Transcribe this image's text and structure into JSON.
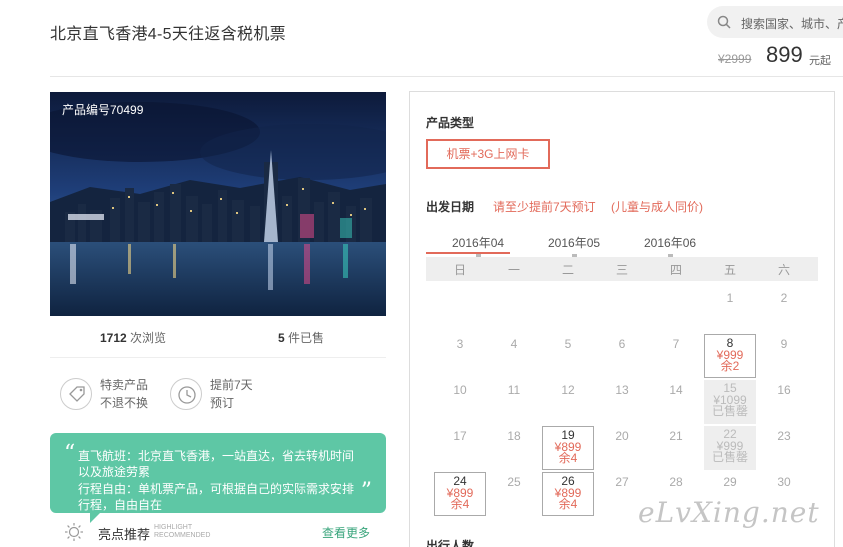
{
  "header": {
    "title": "北京直飞香港4-5天往返含税机票",
    "search_placeholder": "搜索国家、城市、产",
    "price_old": "¥2999",
    "price_new": "899",
    "price_suffix": "元起"
  },
  "gallery": {
    "product_code": "产品编号70499"
  },
  "stats": {
    "views_num": "1712",
    "views_label": "次浏览",
    "sold_num": "5",
    "sold_label": "件已售"
  },
  "features": [
    {
      "line1": "特卖产品",
      "line2": "不退不换",
      "icon": "tag-icon"
    },
    {
      "line1": "提前7天",
      "line2": "预订",
      "icon": "clock-icon"
    }
  ],
  "highlights": {
    "lines": [
      "直飞航班：北京直飞香港，一站直达，省去转机时间",
      "以及旅途劳累",
      "行程自由：单机票产品，可根据自己的实际需求安排",
      "行程，自由自在"
    ],
    "label": "亮点推荐",
    "label_en_1": "HIGHLIGHT",
    "label_en_2": "RECOMMENDED",
    "more": "查看更多"
  },
  "booking": {
    "product_type_label": "产品类型",
    "product_type_option": "机票+3G上网卡",
    "departure_label": "出发日期",
    "notice_1": "请至少提前7天预订",
    "notice_2": "(儿童与成人同价)",
    "months": [
      "2016年04",
      "2016年05",
      "2016年06"
    ],
    "weekdays": [
      "日",
      "一",
      "二",
      "三",
      "四",
      "五",
      "六"
    ],
    "travelers_label": "出行人数"
  },
  "calendar": [
    {
      "day": "1",
      "state": "none"
    },
    {
      "day": "2",
      "state": "none"
    },
    {
      "day": "3",
      "state": "none"
    },
    {
      "day": "4",
      "state": "none"
    },
    {
      "day": "5",
      "state": "none"
    },
    {
      "day": "6",
      "state": "none"
    },
    {
      "day": "7",
      "state": "none"
    },
    {
      "day": "8",
      "state": "active",
      "price": "¥999",
      "remain": "余2"
    },
    {
      "day": "9",
      "state": "none"
    },
    {
      "day": "10",
      "state": "none"
    },
    {
      "day": "11",
      "state": "none"
    },
    {
      "day": "12",
      "state": "none"
    },
    {
      "day": "13",
      "state": "none"
    },
    {
      "day": "14",
      "state": "none"
    },
    {
      "day": "15",
      "state": "sold",
      "price": "¥1099",
      "remain": "已售罄"
    },
    {
      "day": "16",
      "state": "none"
    },
    {
      "day": "17",
      "state": "none"
    },
    {
      "day": "18",
      "state": "none"
    },
    {
      "day": "19",
      "state": "active",
      "price": "¥899",
      "remain": "余4"
    },
    {
      "day": "20",
      "state": "none"
    },
    {
      "day": "21",
      "state": "none"
    },
    {
      "day": "22",
      "state": "sold",
      "price": "¥999",
      "remain": "已售罄"
    },
    {
      "day": "23",
      "state": "none"
    },
    {
      "day": "24",
      "state": "active",
      "price": "¥899",
      "remain": "余4"
    },
    {
      "day": "25",
      "state": "none"
    },
    {
      "day": "26",
      "state": "active",
      "price": "¥899",
      "remain": "余4"
    },
    {
      "day": "27",
      "state": "none"
    },
    {
      "day": "28",
      "state": "none"
    },
    {
      "day": "29",
      "state": "none"
    },
    {
      "day": "30",
      "state": "none"
    }
  ],
  "watermark": "eLvXing.net"
}
